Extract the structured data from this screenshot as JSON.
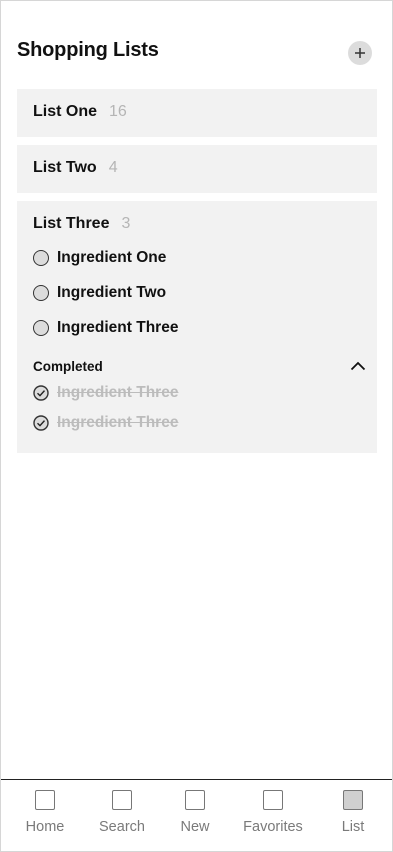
{
  "header": {
    "title": "Shopping Lists",
    "add_icon": "plus-icon"
  },
  "lists": [
    {
      "name": "List One",
      "count": "16"
    },
    {
      "name": "List Two",
      "count": "4"
    },
    {
      "name": "List Three",
      "count": "3",
      "items": [
        "Ingredient One",
        "Ingredient Two",
        "Ingredient Three"
      ],
      "completed_label": "Completed",
      "completed_items": [
        "Ingredient Three",
        "Ingredient Three"
      ]
    }
  ],
  "tabs": [
    {
      "label": "Home",
      "icon": "home-icon"
    },
    {
      "label": "Search",
      "icon": "search-icon"
    },
    {
      "label": "New",
      "icon": "new-icon"
    },
    {
      "label": "Favorites",
      "icon": "favorites-icon"
    },
    {
      "label": "List",
      "icon": "list-icon",
      "active": true
    }
  ],
  "colors": {
    "card_bg": "#f2f2f2",
    "muted_text": "#b5b5b5",
    "tab_label": "#7a7a7a"
  }
}
